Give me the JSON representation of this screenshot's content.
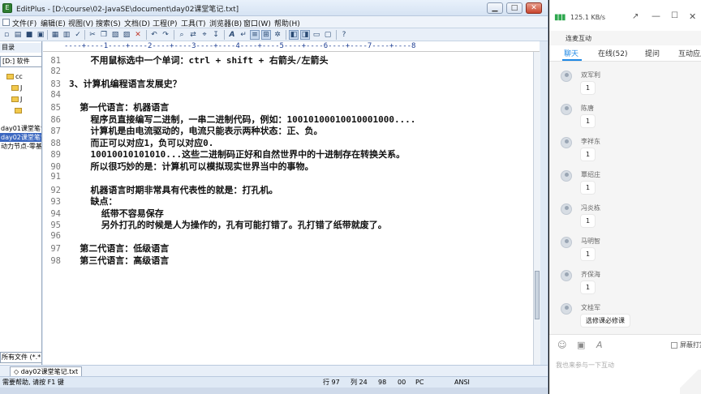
{
  "editor": {
    "title": "EditPlus - [D:\\course\\02-JavaSE\\document\\day02课堂笔记.txt]",
    "window_buttons": {
      "minimize": "▁",
      "maximize": "□",
      "close": "✕"
    },
    "menus": [
      "文件(F)",
      "编辑(E)",
      "视图(V)",
      "搜索(S)",
      "文档(D)",
      "工程(P)",
      "工具(T)",
      "浏览器(B)",
      "窗口(W)",
      "帮助(H)"
    ],
    "ruler": "----+----1----+----2----+----3----+----4----+----5----+----6----+----7----+----8",
    "left_panel": {
      "dir_label": "目录",
      "drive": "[D:] 软件",
      "folders": [
        "cc",
        "J",
        "J",
        ""
      ],
      "files": [
        "day01课堂笔记",
        "day02课堂笔记",
        "动力节点-零基"
      ],
      "filter": "所有文件 (*.*)"
    },
    "lines": [
      {
        "no": "81",
        "text": "    不用鼠标选中一个单词：ctrl + shift + 右箭头/左箭头"
      },
      {
        "no": "82",
        "text": ""
      },
      {
        "no": "83",
        "text": "3、计算机编程语言发展史？"
      },
      {
        "no": "84",
        "text": ""
      },
      {
        "no": "85",
        "text": "  第一代语言：机器语言"
      },
      {
        "no": "86",
        "text": "    程序员直接编写二进制，一串二进制代码，例如：10010100010010001000...."
      },
      {
        "no": "87",
        "text": "    计算机是由电流驱动的，电流只能表示两种状态：正、负。"
      },
      {
        "no": "88",
        "text": "    而正可以对应1，负可以对应0."
      },
      {
        "no": "89",
        "text": "    10010010101010...这些二进制码正好和自然世界中的十进制存在转换关系。"
      },
      {
        "no": "90",
        "text": "    所以很巧妙的是：计算机可以模拟现实世界当中的事物。"
      },
      {
        "no": "91",
        "text": ""
      },
      {
        "no": "92",
        "text": "    机器语言时期非常具有代表性的就是：打孔机。"
      },
      {
        "no": "93",
        "text": "    缺点："
      },
      {
        "no": "94",
        "text": "      纸带不容易保存"
      },
      {
        "no": "95",
        "text": "      另外打孔的时候是人为操作的，孔有可能打错了。孔打错了纸带就废了。"
      },
      {
        "no": "96",
        "text": ""
      },
      {
        "no": "97",
        "text": "  第二代语言：低级语言"
      },
      {
        "no": "98",
        "text": "  第三代语言：高级语言"
      }
    ],
    "tab": "◇ day02课堂笔记.txt",
    "status": {
      "help": "需要帮助, 请按 F1 键",
      "line": "行 97",
      "col": "列 24",
      "chars": "98",
      "num": "00",
      "eol": "PC",
      "encoding": "ANSI"
    }
  },
  "live": {
    "net_speed": "125.1 KB/s",
    "title": "连麦互动",
    "tabs": [
      "聊天",
      "在线(52)",
      "提问",
      "互动应用"
    ],
    "messages": [
      {
        "name": "双军利",
        "text": "1"
      },
      {
        "name": "陈唐",
        "text": "1"
      },
      {
        "name": "李祥东",
        "text": "1"
      },
      {
        "name": "覃绍庄",
        "text": "1"
      },
      {
        "name": "冯炎栋",
        "text": "1"
      },
      {
        "name": "马明智",
        "text": "1"
      },
      {
        "name": "齐保海",
        "text": "1"
      },
      {
        "name": "文桂军",
        "text": "选修课必修课"
      }
    ],
    "block_label": "屏蔽打赏",
    "input_placeholder": "我也来参与一下互动",
    "accent": "#1e88e5"
  }
}
